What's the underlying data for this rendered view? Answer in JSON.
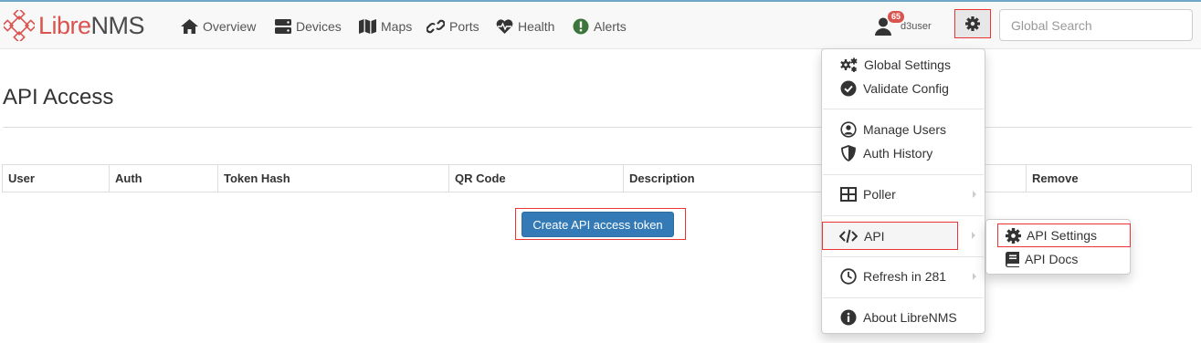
{
  "brand": {
    "part1": "Libre",
    "part2": "NMS"
  },
  "nav": [
    {
      "label": "Overview",
      "icon": "home-icon"
    },
    {
      "label": "Devices",
      "icon": "server-icon"
    },
    {
      "label": "Maps",
      "icon": "map-icon"
    },
    {
      "label": "Ports",
      "icon": "link-icon"
    },
    {
      "label": "Health",
      "icon": "heartbeat-icon"
    },
    {
      "label": "Alerts",
      "icon": "exclamation-circle-icon"
    }
  ],
  "user": {
    "notification_count": "65",
    "name": "d3user"
  },
  "search": {
    "placeholder": "Global Search"
  },
  "page": {
    "title": "API Access"
  },
  "table": {
    "headers": [
      "User",
      "Auth",
      "Token Hash",
      "QR Code",
      "Description",
      "",
      "Remove"
    ]
  },
  "actions": {
    "create_token": "Create API access token"
  },
  "settings_menu": {
    "items": [
      "Global Settings",
      "Validate Config",
      "Manage Users",
      "Auth History",
      "Poller",
      "API",
      "Refresh in 281",
      "About LibreNMS"
    ]
  },
  "api_submenu": {
    "items": [
      "API Settings",
      "API Docs"
    ]
  },
  "colors": {
    "brand_red": "#d9534f",
    "primary": "#337ab7",
    "highlight": "#ee3333"
  }
}
